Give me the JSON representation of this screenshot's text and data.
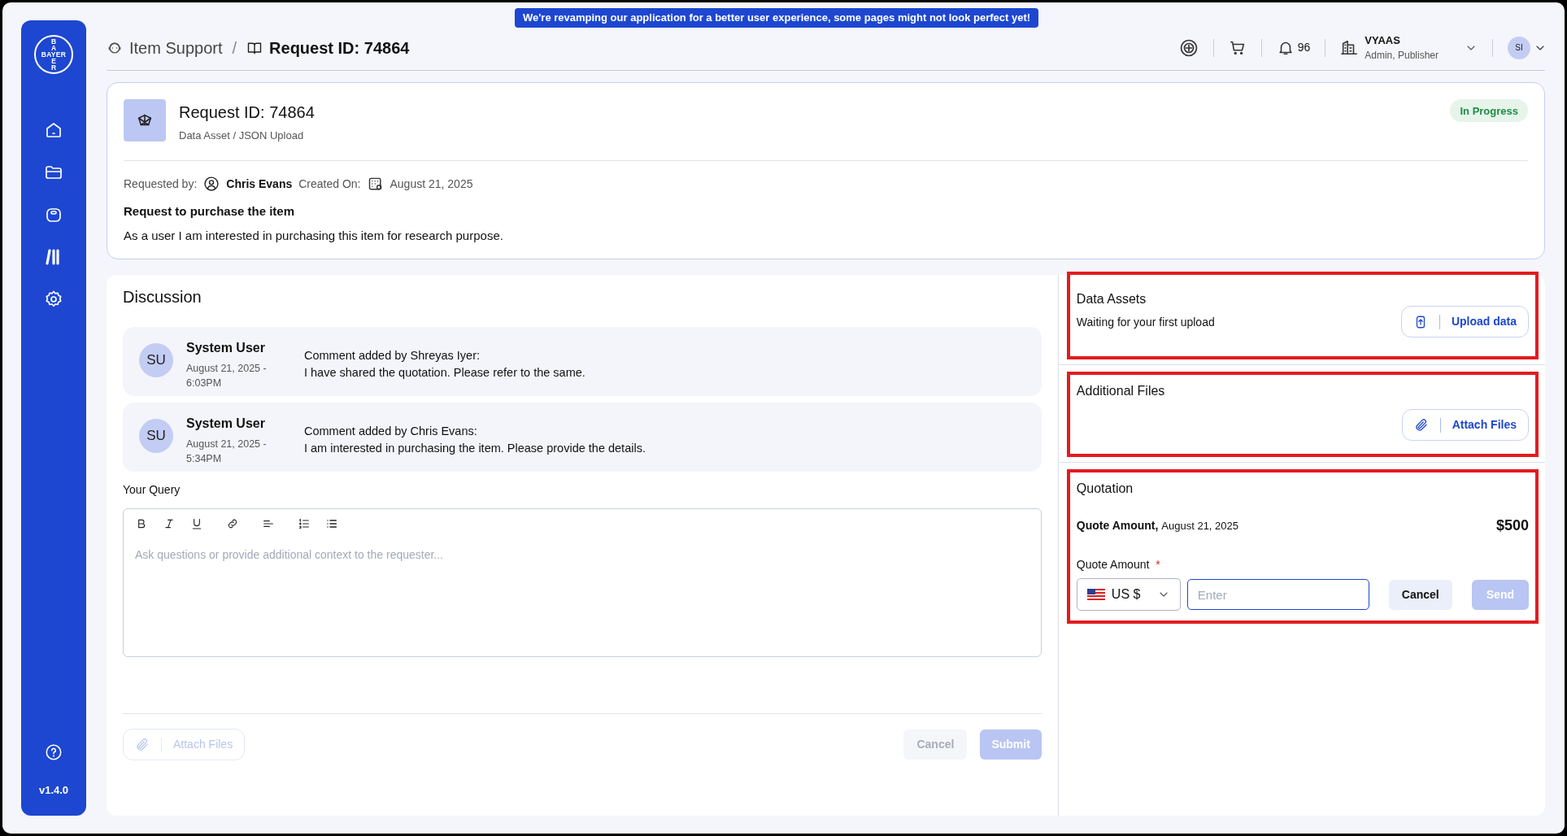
{
  "banner": "We're revamping our application for a better user experience, some pages might not look perfect yet!",
  "sidebar": {
    "logo": {
      "across": "BAYER",
      "top": "BA",
      "bottom": "ER"
    },
    "version": "v1.4.0"
  },
  "header": {
    "breadcrumbs": [
      {
        "label": "Item Support",
        "current": false
      },
      {
        "label": "Request ID: 74864",
        "current": true
      }
    ],
    "separator": "/",
    "notifications": "96",
    "user": {
      "name": "VYAAS",
      "roles": "Admin, Publisher"
    },
    "avatar": "SI"
  },
  "request": {
    "title": "Request ID: 74864",
    "subtitle": "Data Asset / JSON Upload",
    "status": "In Progress",
    "requested_by_label": "Requested by:",
    "requester": "Chris Evans",
    "created_label": "Created On:",
    "created": "August 21, 2025",
    "heading": "Request to purchase the item",
    "description": "As a user I am interested in purchasing this item for research purpose."
  },
  "discussion": {
    "title": "Discussion",
    "comments": [
      {
        "initials": "SU",
        "author": "System User",
        "date": "August 21, 2025 - 6:03PM",
        "heading": "Comment added by Shreyas Iyer:",
        "text": "I have shared the quotation. Please refer to the same."
      },
      {
        "initials": "SU",
        "author": "System User",
        "date": "August 21, 2025 - 5:34PM",
        "heading": "Comment added by Chris Evans:",
        "text": "I am interested in purchasing the item. Please provide the details."
      }
    ],
    "query_label": "Your Query",
    "placeholder": "Ask questions or provide additional context to the requester...",
    "attach": {
      "label": "Attach Files",
      "disabled": true
    },
    "cancel": {
      "label": "Cancel",
      "disabled": true
    },
    "submit": {
      "label": "Submit",
      "disabled": true
    }
  },
  "data_assets": {
    "title": "Data Assets",
    "text": "Waiting for your first upload",
    "button": "Upload data",
    "highlighted": true
  },
  "additional_files": {
    "title": "Additional Files",
    "button": "Attach Files",
    "highlighted": true
  },
  "quotation": {
    "title": "Quotation",
    "amount_label": "Quote Amount,",
    "amount_date": "August 21, 2025",
    "amount": "$500",
    "field_label": "Quote Amount",
    "required_mark": "*",
    "currency": "US $",
    "placeholder": "Enter",
    "cancel": {
      "label": "Cancel",
      "disabled": false
    },
    "send": {
      "label": "Send",
      "disabled": true
    },
    "highlighted": true
  }
}
